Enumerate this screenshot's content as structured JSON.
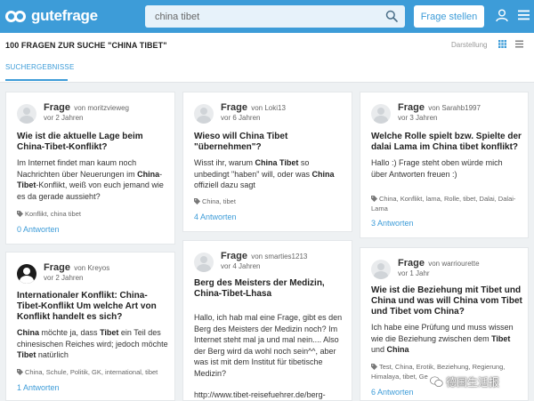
{
  "header": {
    "logo": "gutefrage",
    "search_value": "china tibet",
    "ask_button": "Frage stellen",
    "icons": [
      "search-icon",
      "user-icon",
      "menu-icon"
    ]
  },
  "subheader": {
    "results_title": "100 FRAGEN ZUR SUCHE \"CHINA TIBET\"",
    "view_label": "Darstellung",
    "tab": "SUCHERGEBNISSE"
  },
  "colors": {
    "brand": "#3d9cd8",
    "background": "#eef1f3"
  },
  "cards": [
    {
      "kind": "Frage",
      "by": "von moritzvieweg",
      "time": "vor 2 Jahren",
      "title": "Wie ist die aktuelle Lage beim China-Tibet-Konflikt?",
      "body_html": "Im Internet findet man kaum noch Nachrichten über Neuerungen im <b>China</b>-<b>Tibet</b>-Konflikt, weiß von euch jemand wie es da gerade aussieht?",
      "tags": "Konflikt, china tibet",
      "answers": "0 Antworten"
    },
    {
      "kind": "Frage",
      "by": "von Loki13",
      "time": "vor 6 Jahren",
      "title": "Wieso will China Tibet \"übernehmen\"?",
      "body_html": "Wisst ihr, warum <b>China Tibet</b> so unbedingt \"haben\" will, oder was <b>China</b> offiziell dazu sagt",
      "tags": "China, tibet",
      "answers": "4 Antworten"
    },
    {
      "kind": "Frage",
      "by": "von Sarahb1997",
      "time": "vor 3 Jahren",
      "title": "Welche Rolle spielt bzw. Spielte der dalai Lama im China tibet konflikt?",
      "body_html": "Hallo :) Frage steht oben würde mich über Antworten freuen :)",
      "tags": "China, Konflikt, lama, Rolle, tibet, Dalai, Dalai-Lama",
      "answers": "3 Antworten"
    },
    {
      "kind": "Frage",
      "by": "von Kreyos",
      "time": "vor 2 Jahren",
      "title": "Internationaler Konflikt: China-Tibet-Konflikt Um welche Art von Konflikt handelt es sich?",
      "body_html": "<b>China</b> möchte ja, dass <b>Tibet</b> ein Teil des chinesischen Reiches wird; jedoch möchte <b>Tibet</b> natürlich",
      "tags": "China, Schule, Politik, GK, international, tibet",
      "answers": "1 Antworten"
    },
    {
      "kind": "Frage",
      "by": "von smarties1213",
      "time": "vor 4 Jahren",
      "title": "Berg des Meisters der Medizin, China-Tibet-Lhasa",
      "body_html": "Hallo, ich hab mal eine Frage, gibt es den Berg des Meisters der Medizin noch? Im Internet steht mal ja und mal nein.... Also der Berg wird da wohl noch sein^^, aber was ist mit dem Institut für tibetische Medizin?",
      "link": "http://www.tibet-reisefuehrer.de/berg-",
      "tags": "",
      "answers": ""
    },
    {
      "kind": "Frage",
      "by": "von warriourette",
      "time": "vor 1 Jahr",
      "title": "Wie ist die Beziehung mit Tibet und China und was will China vom Tibet und Tibet vom China?",
      "body_html": "Ich habe eine Prüfung und muss wissen wie die Beziehung zwischen dem <b>Tibet</b> und <b>China</b>",
      "tags": "Test, China, Erotik, Beziehung, Regierung, Himalaya, tibet, Ge",
      "answers": "6 Antworten"
    }
  ],
  "watermark": "德国生活报"
}
